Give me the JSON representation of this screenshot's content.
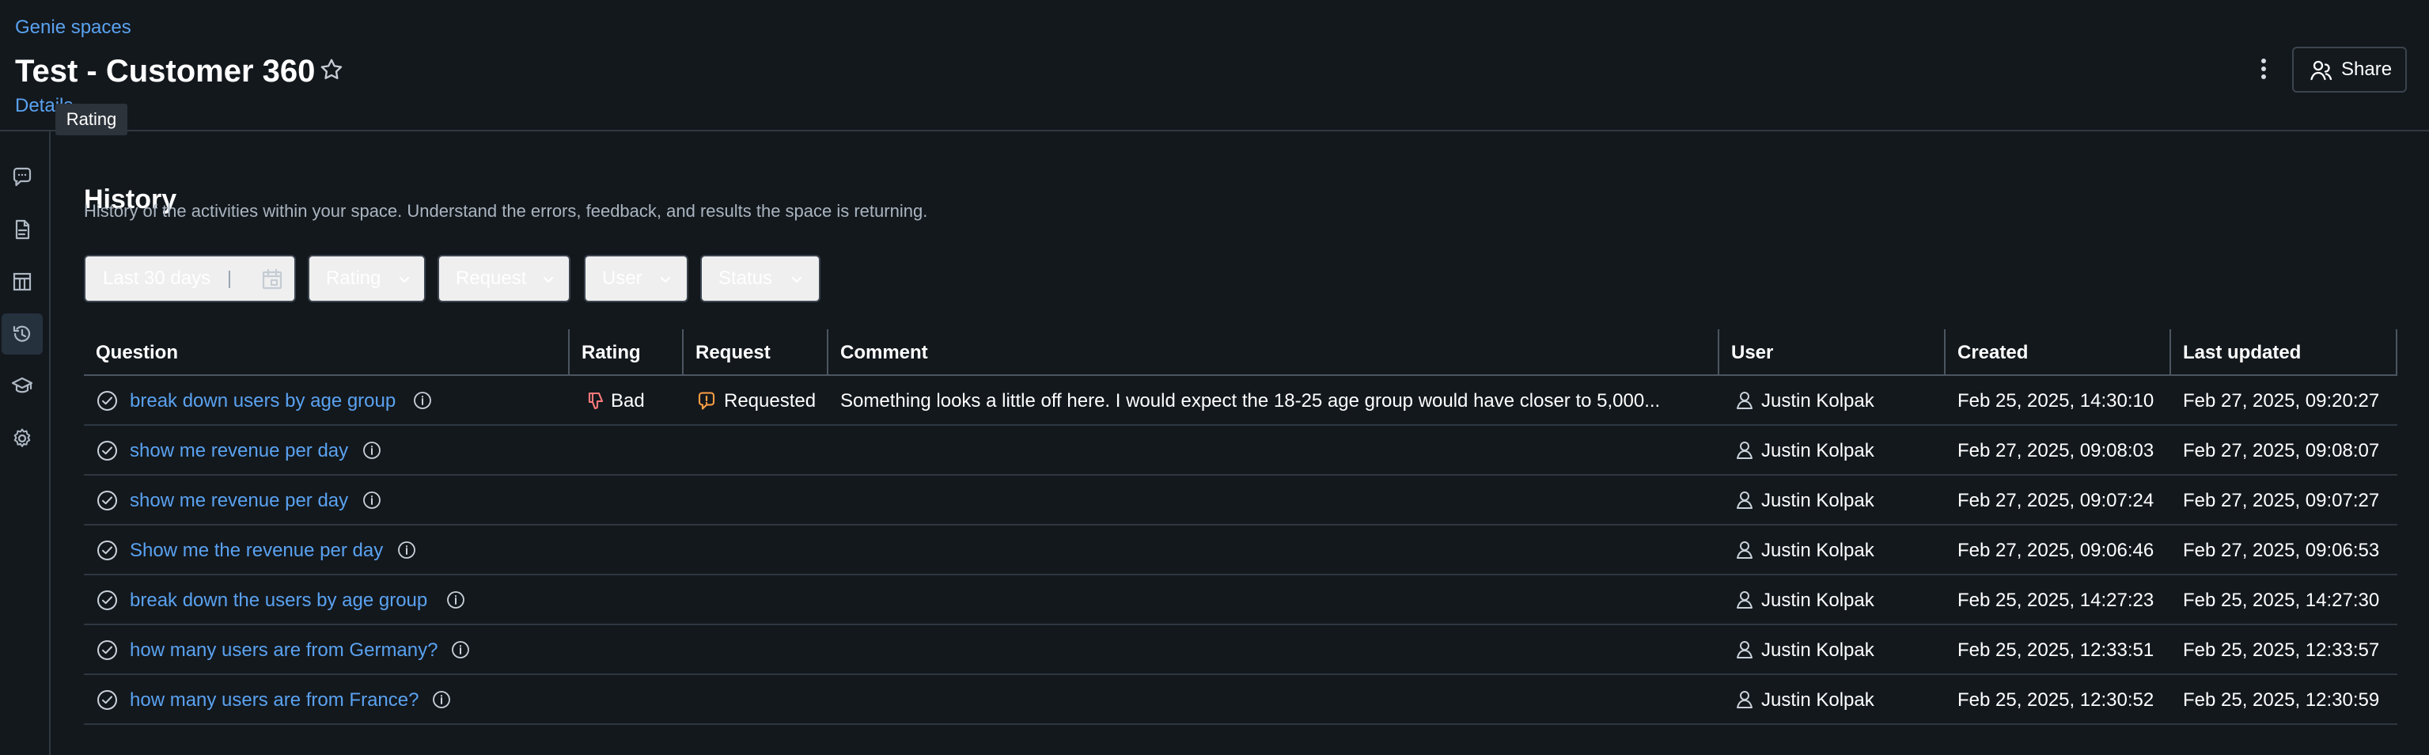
{
  "header": {
    "breadcrumb": "Genie spaces",
    "title": "Test - Customer 360",
    "details_link": "Details",
    "tooltip": "Rating",
    "share_label": "Share"
  },
  "sidebar": {
    "items": [
      {
        "name": "chat-icon",
        "active": false
      },
      {
        "name": "document-icon",
        "active": false
      },
      {
        "name": "table-icon",
        "active": false
      },
      {
        "name": "history-icon",
        "active": true
      },
      {
        "name": "graduation-cap-icon",
        "active": false
      },
      {
        "name": "gear-icon",
        "active": false
      }
    ]
  },
  "history": {
    "title": "History",
    "description": "History of the activities within your space. Understand the errors, feedback, and results the space is returning."
  },
  "filters": {
    "date_range": "Last 30 days",
    "rating": "Rating",
    "request": "Request",
    "user": "User",
    "status": "Status"
  },
  "table": {
    "columns": [
      "Question",
      "Rating",
      "Request",
      "Comment",
      "User",
      "Created",
      "Last updated"
    ],
    "rows": [
      {
        "question": "break down users by age group",
        "rating": "Bad",
        "request": "Requested",
        "comment": "Something looks a little off here. I would expect the 18-25 age group would have closer to 5,000...",
        "user": "Justin Kolpak",
        "created": "Feb 25, 2025, 14:30:10",
        "last_updated": "Feb 27, 2025, 09:20:27"
      },
      {
        "question": "show me revenue per day",
        "rating": "",
        "request": "",
        "comment": "",
        "user": "Justin Kolpak",
        "created": "Feb 27, 2025, 09:08:03",
        "last_updated": "Feb 27, 2025, 09:08:07"
      },
      {
        "question": "show me revenue per day",
        "rating": "",
        "request": "",
        "comment": "",
        "user": "Justin Kolpak",
        "created": "Feb 27, 2025, 09:07:24",
        "last_updated": "Feb 27, 2025, 09:07:27"
      },
      {
        "question": "Show me the revenue per day",
        "rating": "",
        "request": "",
        "comment": "",
        "user": "Justin Kolpak",
        "created": "Feb 27, 2025, 09:06:46",
        "last_updated": "Feb 27, 2025, 09:06:53"
      },
      {
        "question": "break down the users by age group",
        "rating": "",
        "request": "",
        "comment": "",
        "user": "Justin Kolpak",
        "created": "Feb 25, 2025, 14:27:23",
        "last_updated": "Feb 25, 2025, 14:27:30"
      },
      {
        "question": "how many users are from Germany?",
        "rating": "",
        "request": "",
        "comment": "",
        "user": "Justin Kolpak",
        "created": "Feb 25, 2025, 12:33:51",
        "last_updated": "Feb 25, 2025, 12:33:57"
      },
      {
        "question": "how many users are from France?",
        "rating": "",
        "request": "",
        "comment": "",
        "user": "Justin Kolpak",
        "created": "Feb 25, 2025, 12:30:52",
        "last_updated": "Feb 25, 2025, 12:30:59"
      }
    ]
  },
  "colors": {
    "background": "#13181d",
    "link": "#5aa2f0",
    "rating_bad": "#ff7a7a",
    "requested": "#ff9f43"
  }
}
